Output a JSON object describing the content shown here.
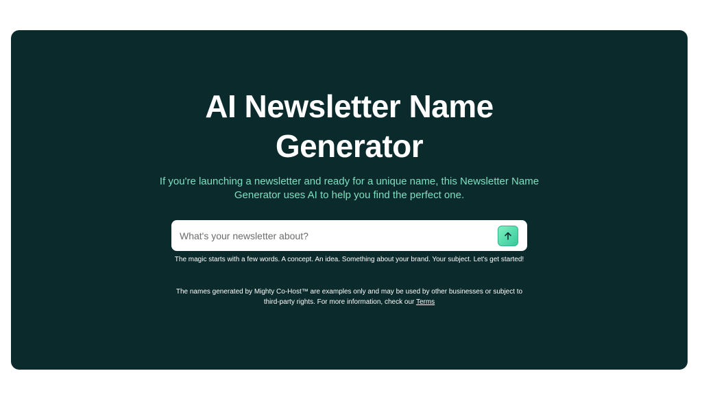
{
  "hero": {
    "title_line1": "AI Newsletter Name",
    "title_line2": "Generator",
    "subtitle": "If you're launching a newsletter and ready for a unique name, this Newsletter Name Generator uses AI to help you find the perfect one."
  },
  "search": {
    "placeholder": "What's your newsletter about?",
    "value": "",
    "submit_icon": "arrow-up-icon"
  },
  "helper_text": "The magic starts with a few words. A concept. An idea. Something about your brand. Your subject. Let's get started!",
  "disclaimer": {
    "text": "The names generated by Mighty Co-Host™ are examples only and may be used by other businesses or subject to third-party rights. For more information, check our",
    "link_label": "Terms"
  },
  "colors": {
    "card_background": "#0b2a2c",
    "subtitle": "#7ee0c2",
    "button_accent": "#35c99a"
  }
}
